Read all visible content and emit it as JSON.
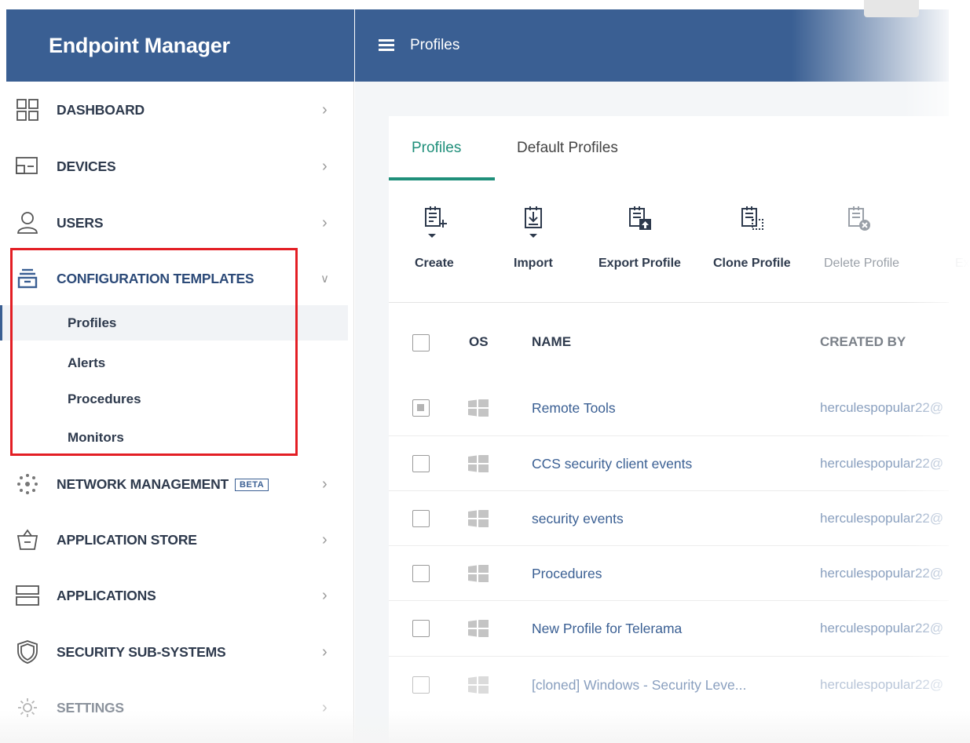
{
  "app": {
    "title": "Endpoint Manager"
  },
  "header": {
    "page_title": "Profiles"
  },
  "sidebar": {
    "items": [
      {
        "label": "DASHBOARD",
        "icon": "dashboard-icon"
      },
      {
        "label": "DEVICES",
        "icon": "devices-icon"
      },
      {
        "label": "USERS",
        "icon": "user-icon"
      },
      {
        "label": "CONFIGURATION TEMPLATES",
        "icon": "templates-icon",
        "expanded": true
      },
      {
        "label": "NETWORK MANAGEMENT",
        "icon": "network-icon",
        "badge": "BETA"
      },
      {
        "label": "APPLICATION STORE",
        "icon": "store-icon"
      },
      {
        "label": "APPLICATIONS",
        "icon": "applications-icon"
      },
      {
        "label": "SECURITY SUB-SYSTEMS",
        "icon": "shield-icon"
      },
      {
        "label": "SETTINGS",
        "icon": "gear-icon"
      }
    ],
    "subitems": [
      {
        "label": "Profiles",
        "active": true
      },
      {
        "label": "Alerts"
      },
      {
        "label": "Procedures"
      },
      {
        "label": "Monitors"
      }
    ]
  },
  "tabs": [
    {
      "label": "Profiles",
      "active": true
    },
    {
      "label": "Default Profiles"
    }
  ],
  "toolbar": [
    {
      "label": "Create",
      "icon": "create-profile-icon"
    },
    {
      "label": "Import",
      "icon": "import-profile-icon"
    },
    {
      "label": "Export Profile",
      "icon": "export-profile-icon"
    },
    {
      "label": "Clone Profile",
      "icon": "clone-profile-icon"
    },
    {
      "label": "Delete Profile",
      "icon": "delete-profile-icon",
      "disabled": true
    },
    {
      "label": "Ex",
      "icon": "export-icon",
      "disabled": true
    }
  ],
  "table": {
    "columns": [
      "OS",
      "NAME",
      "CREATED BY"
    ],
    "rows": [
      {
        "os": "windows-icon",
        "name": "Remote Tools",
        "created_by": "herculespopular22@",
        "checked": true
      },
      {
        "os": "windows-icon",
        "name": "CCS security client events",
        "created_by": "herculespopular22@"
      },
      {
        "os": "windows-icon",
        "name": "security events",
        "created_by": "herculespopular22@"
      },
      {
        "os": "windows-icon",
        "name": "Procedures",
        "created_by": "herculespopular22@"
      },
      {
        "os": "windows-icon",
        "name": "New Profile for Telerama",
        "created_by": "herculespopular22@"
      },
      {
        "os": "windows-icon",
        "name": "[cloned] Windows - Security Leve...",
        "created_by": "herculespopular22@"
      }
    ]
  },
  "colors": {
    "brand": "#3a5f93",
    "accent": "#1f8f7a",
    "highlight": "#e31e24"
  }
}
